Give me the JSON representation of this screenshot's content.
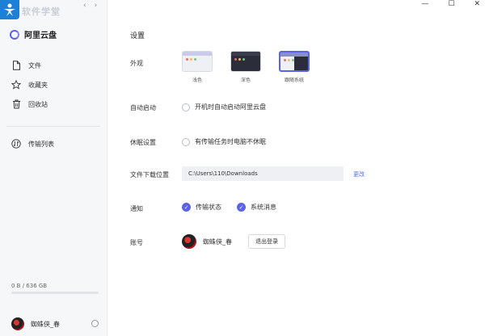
{
  "window": {
    "minimize_glyph": "—",
    "maximize_glyph": "☐",
    "close_glyph": "✕"
  },
  "sidebar": {
    "watermark": "软件学堂",
    "back_glyph": "‹",
    "forward_glyph": "›",
    "brand": "阿里云盘",
    "items": [
      {
        "label": "文件",
        "icon": "file-icon"
      },
      {
        "label": "收藏夹",
        "icon": "star-icon"
      },
      {
        "label": "回收站",
        "icon": "trash-icon"
      },
      {
        "label": "传输列表",
        "icon": "transfer-icon"
      }
    ],
    "storage": "0 B / 636 GB",
    "storage_used_fraction": 0.0,
    "username": "蜘蛛侠_春"
  },
  "settings": {
    "title": "设置",
    "appearance": {
      "label": "外观",
      "options": [
        {
          "name": "浅色",
          "selected": false
        },
        {
          "name": "深色",
          "selected": false
        },
        {
          "name": "跟随系统",
          "selected": true
        }
      ]
    },
    "autostart": {
      "label": "自动启动",
      "option": "开机时自动启动阿里云盘",
      "checked": false
    },
    "sleep": {
      "label": "休眠设置",
      "option": "有传输任务时电脑不休眠",
      "checked": false
    },
    "download": {
      "label": "文件下载位置",
      "path": "C:\\Users\\110\\Downloads",
      "change": "更改"
    },
    "notify": {
      "label": "通知",
      "transfer": "传输状态",
      "system": "系统消息"
    },
    "account": {
      "label": "账号",
      "name": "蜘蛛侠_春",
      "logout": "退出登录"
    }
  },
  "colors": {
    "accent": "#5a62e8",
    "link": "#4d6fe0",
    "sidebar_bg": "#f6f7f9"
  }
}
